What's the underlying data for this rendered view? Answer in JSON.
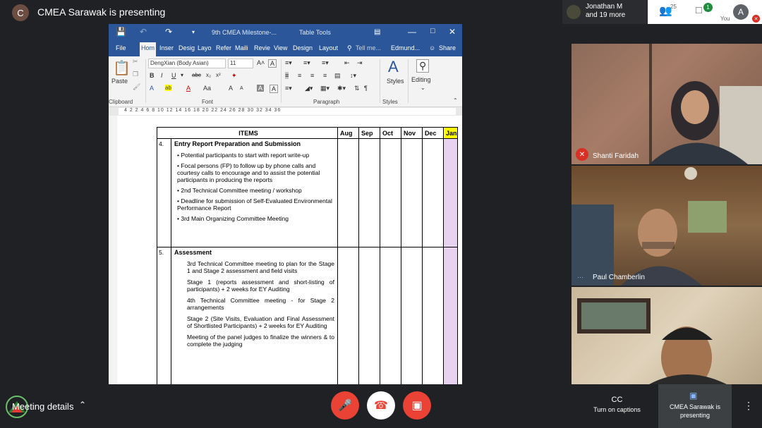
{
  "topbar": {
    "presenter_initial": "C",
    "presenter_title": "CMEA Sarawak is presenting",
    "people_name_line1": "Jonathan M",
    "people_name_line2": "and 19 more",
    "people_count": "25",
    "chat_badge": "1",
    "me_initial": "A",
    "me_label": "You"
  },
  "word": {
    "doc_title": "9th CMEA Milestone-...",
    "table_tools": "Table Tools",
    "tabs": [
      "File",
      "Hom",
      "Inser",
      "Desig",
      "Layo",
      "Refer",
      "Maili",
      "Revie",
      "View",
      "Design",
      "Layout"
    ],
    "tell_me": "Tell me...",
    "user": "Edmund...",
    "share": "Share",
    "font_name": "DengXian (Body Asian)",
    "font_size": "11",
    "groups": {
      "clipboard": "Clipboard",
      "font": "Font",
      "paragraph": "Paragraph",
      "styles": "Styles"
    },
    "paste": "Paste",
    "styles_btn": "Styles",
    "editing_btn": "Editing",
    "ruler": "4  2     2   4   6   8   10   12   14   16   18   20   22   24   26   28   30   32   34  36"
  },
  "table": {
    "header": {
      "items": "ITEMS",
      "months": [
        "Aug",
        "Sep",
        "Oct",
        "Nov",
        "Dec",
        "Jan"
      ]
    },
    "section4": {
      "num": "4.",
      "title": "Entry Report Preparation and Submission",
      "bullets": [
        "Potential participants to start with report write-up",
        "Focal persons (FP) to follow up by phone calls and courtesy calls to encourage and to assist the potential participants in producing the reports",
        "2nd Technical Committee meeting / workshop",
        "Deadline for submission of Self-Evaluated Environmental Performance Report",
        "3rd Main Organizing Committee Meeting"
      ]
    },
    "section5": {
      "num": "5.",
      "title": "Assessment",
      "bullets": [
        "3rd Technical Committee meeting to plan for the Stage 1 and Stage 2 assessment and field visits",
        "Stage 1 (reports assessment and short-listing of participants) + 2 weeks for EY Auditing",
        "4th Technical Committee meeting - for Stage 2 arrangements",
        "Stage 2 (Site Visits, Evaluation and Final Assessment of Shortlisted Participants) + 2 weeks for EY Auditing",
        "Meeting of the panel judges to finalize the winners & to complete the judging"
      ]
    }
  },
  "participants": [
    {
      "name": "Shanti Faridah"
    },
    {
      "name": "Paul Chamberlin"
    }
  ],
  "bottombar": {
    "meeting_details": "Meeting details",
    "captions": "Turn on captions",
    "captions_icon": "CC",
    "presenting": "CMEA Sarawak is presenting"
  },
  "colors": {
    "word_blue": "#2b579a",
    "end_red": "#ea4335",
    "jan_highlight": "#ffff00",
    "jan_column": "#e7d3f0"
  }
}
